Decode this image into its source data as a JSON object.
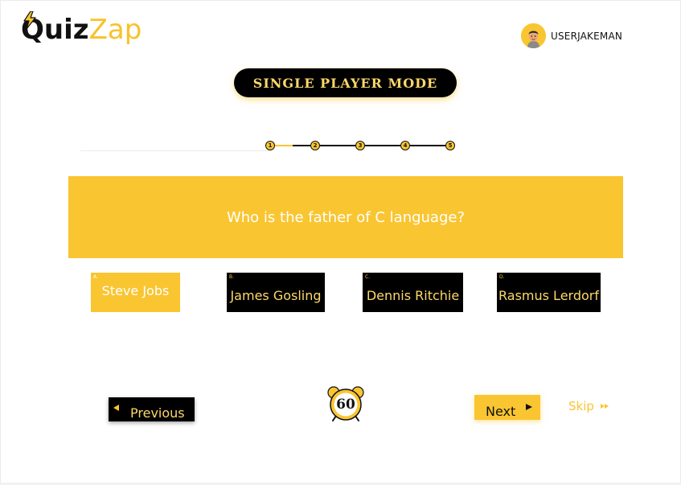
{
  "app": {
    "logo_primary": "Quiz",
    "logo_accent": "Zap"
  },
  "user": {
    "username": "USERJAKEMAN",
    "avatar_icon": "user-avatar-icon"
  },
  "mode": {
    "label": "SINGLE PLAYER MODE"
  },
  "progress": {
    "current_step": 1,
    "steps": [
      {
        "label": "1",
        "state": "current"
      },
      {
        "label": "2",
        "state": "upcoming"
      },
      {
        "label": "3",
        "state": "upcoming"
      },
      {
        "label": "4",
        "state": "upcoming"
      },
      {
        "label": "5",
        "state": "upcoming"
      }
    ]
  },
  "question": {
    "text": "Who is the father of C language?"
  },
  "options": [
    {
      "letter": "A.",
      "label": "Steve Jobs",
      "selected": true
    },
    {
      "letter": "B.",
      "label": "James Gosling",
      "selected": false
    },
    {
      "letter": "C.",
      "label": "Dennis Ritchie",
      "selected": false
    },
    {
      "letter": "D.",
      "label": "Rasmus Lerdorf",
      "selected": false
    }
  ],
  "nav": {
    "previous_label": "Previous",
    "next_label": "Next",
    "skip_label": "Skip"
  },
  "timer": {
    "value": "60",
    "icon": "alarm-clock-icon"
  },
  "colors": {
    "accent": "#f9c531",
    "accent_light": "#fdd86a",
    "dark": "#000000",
    "text": "#111111"
  }
}
